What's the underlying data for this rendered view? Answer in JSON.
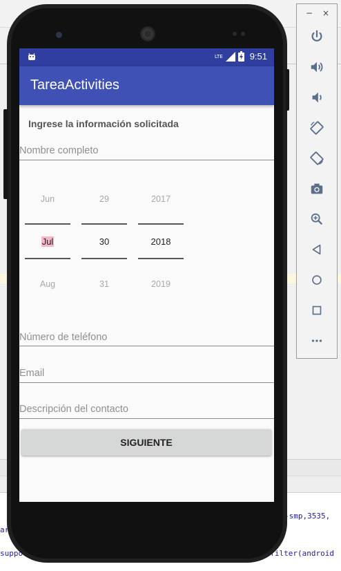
{
  "app": {
    "title": "TareaActivities",
    "status_time": "9:51",
    "status_network": "LTE"
  },
  "form": {
    "prompt": "Ingrese la información solicitada",
    "name_hint": "Nombre completo",
    "phone_hint": "Número de teléfono",
    "email_hint": "Email",
    "description_hint": "Descripción del contacto",
    "next_button": "SIGUIENTE"
  },
  "date_picker": {
    "month": {
      "prev": "Jun",
      "selected": "Jul",
      "next": "Aug"
    },
    "day": {
      "prev": "29",
      "selected": "30",
      "next": "31"
    },
    "year": {
      "prev": "2017",
      "selected": "2018",
      "next": "2019"
    }
  },
  "emulator_panel": {
    "minimize": "−",
    "close": "×",
    "controls": [
      "power-icon",
      "volume-up-icon",
      "volume-down-icon",
      "rotate-left-icon",
      "rotate-right-icon",
      "camera-icon",
      "zoom-icon",
      "back-icon",
      "home-icon",
      "overview-icon",
      "more-icon"
    ]
  },
  "ide": {
    "code_line_1": "-smp,3535,",
    "code_line_2": "ar",
    "code_line_3": "suppor",
    "code_line_4": "ntfilter(android"
  },
  "colors": {
    "status_bar": "#303f9f",
    "app_bar": "#3f51b5",
    "selected_highlight": "#f4b7c7",
    "button_bg": "#d6d7d7"
  }
}
